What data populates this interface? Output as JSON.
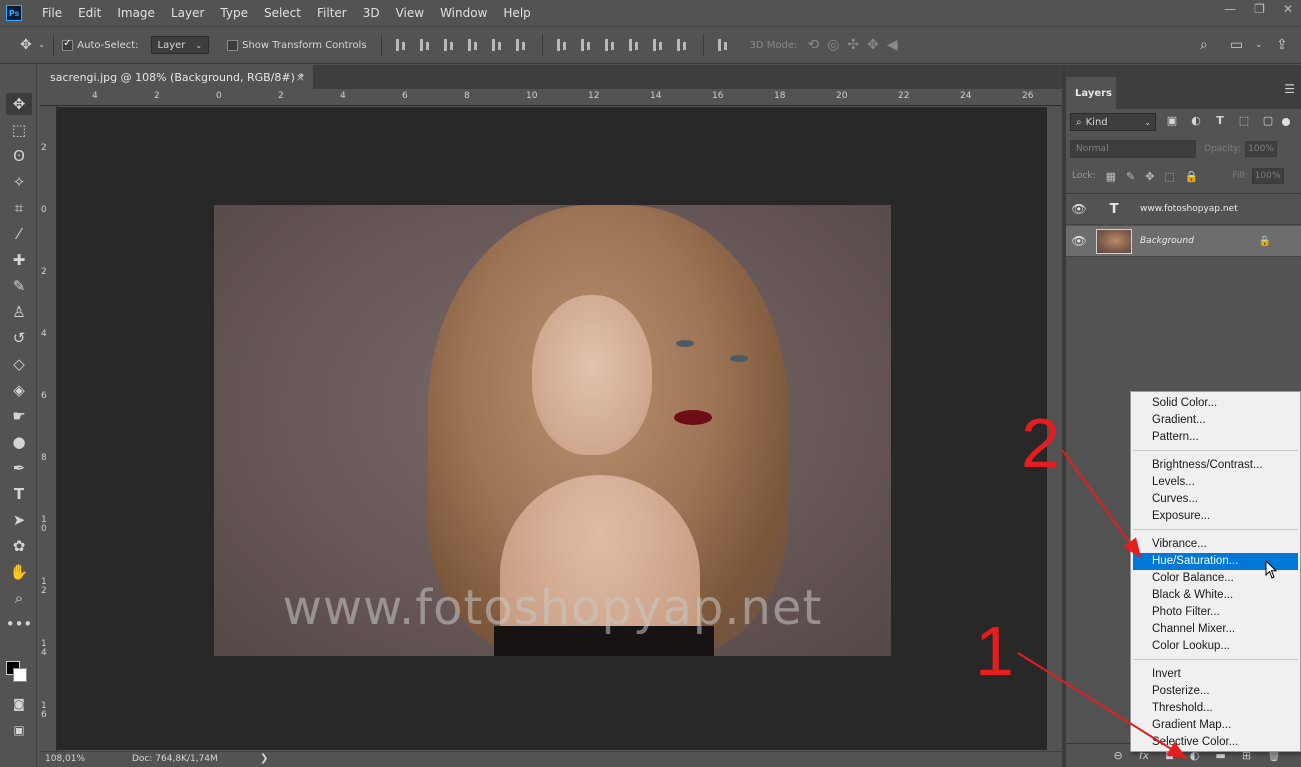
{
  "app": {
    "logo": "Ps",
    "menu": [
      "File",
      "Edit",
      "Image",
      "Layer",
      "Type",
      "Select",
      "Filter",
      "3D",
      "View",
      "Window",
      "Help"
    ],
    "window_controls": {
      "minimize": "—",
      "restore": "❐",
      "close": "✕"
    }
  },
  "options_bar": {
    "auto_select_label": "Auto-Select:",
    "auto_select_value": "Layer",
    "show_transform_label": "Show Transform Controls",
    "mode_3d_label": "3D Mode:"
  },
  "document": {
    "tab_title": "sacrengi.jpg @ 108% (Background, RGB/8#) *",
    "tab_close": "×"
  },
  "ruler_top": [
    "4",
    "2",
    "0",
    "2",
    "4",
    "6",
    "8",
    "10",
    "12",
    "14",
    "16",
    "18",
    "20",
    "22",
    "24",
    "26"
  ],
  "ruler_left": [
    "2",
    "0",
    "2",
    "4",
    "6",
    "8",
    "10",
    "12",
    "14",
    "16"
  ],
  "canvas": {
    "watermark": "www.fotoshopyap.net"
  },
  "status": {
    "zoom": "108,01%",
    "doc": "Doc: 764,8K/1,74M",
    "arrow": "❯"
  },
  "layers_panel": {
    "tab": "Layers",
    "kind": "Kind",
    "blend_mode": "Normal",
    "opacity_label": "Opacity:",
    "opacity_value": "100%",
    "lock_label": "Lock:",
    "fill_label": "Fill:",
    "fill_value": "100%",
    "layers": [
      {
        "name": "www.fotoshopyap.net",
        "type": "text",
        "thumb": "T"
      },
      {
        "name": "Background",
        "type": "image",
        "thumb": ""
      }
    ]
  },
  "adjustment_menu": {
    "groups": [
      [
        "Solid Color...",
        "Gradient...",
        "Pattern..."
      ],
      [
        "Brightness/Contrast...",
        "Levels...",
        "Curves...",
        "Exposure..."
      ],
      [
        "Vibrance...",
        "Hue/Saturation...",
        "Color Balance...",
        "Black & White...",
        "Photo Filter...",
        "Channel Mixer...",
        "Color Lookup..."
      ],
      [
        "Invert",
        "Posterize...",
        "Threshold...",
        "Gradient Map...",
        "Selective Color..."
      ]
    ],
    "highlighted": "Hue/Saturation..."
  },
  "annotations": {
    "step1": "1",
    "step2": "2",
    "color": "#e41e1e"
  },
  "colors": {
    "ui_background": "#535353",
    "canvas_background": "#282828",
    "highlight": "#0078d7"
  }
}
